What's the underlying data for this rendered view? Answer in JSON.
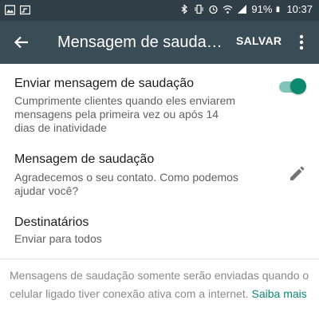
{
  "status_bar": {
    "battery": "91%",
    "time": "10:37",
    "icons": [
      "image-icon",
      "cast-icon",
      "bluetooth-icon",
      "vibrate-icon",
      "alarm-icon",
      "wifi-icon",
      "signal-icon",
      "battery-icon"
    ]
  },
  "app_bar": {
    "title": "Mensagem de saudaç…",
    "save_label": "SALVAR",
    "back_icon": "arrow-back-icon",
    "more_icon": "more-vert-icon"
  },
  "settings": {
    "send_greeting": {
      "title": "Enviar mensagem de saudação",
      "subtitle_line1": "Cumprimente clientes quando eles enviarem",
      "subtitle_line2": "mensagens pela primeira vez ou após 14",
      "subtitle_line3": "dias de inatividade",
      "enabled": true
    },
    "greeting_message": {
      "title": "Mensagem de saudação",
      "subtitle_line1": "Agradecemos o seu contato. Como podemos",
      "subtitle_line2": "ajudar você?",
      "edit_icon": "pencil-icon"
    },
    "recipients": {
      "title": "Destinatários",
      "subtitle": "Enviar para todos"
    }
  },
  "footer": {
    "line1": "Mensagens de saudação somente serão enviadas quando o",
    "line2": "celular ligado tiver conexão ativa com a internet.",
    "link": "Saiba mais"
  },
  "colors": {
    "status_bar": "#303f47",
    "app_bar": "#3a4c55",
    "accent": "#0b8a6f"
  }
}
